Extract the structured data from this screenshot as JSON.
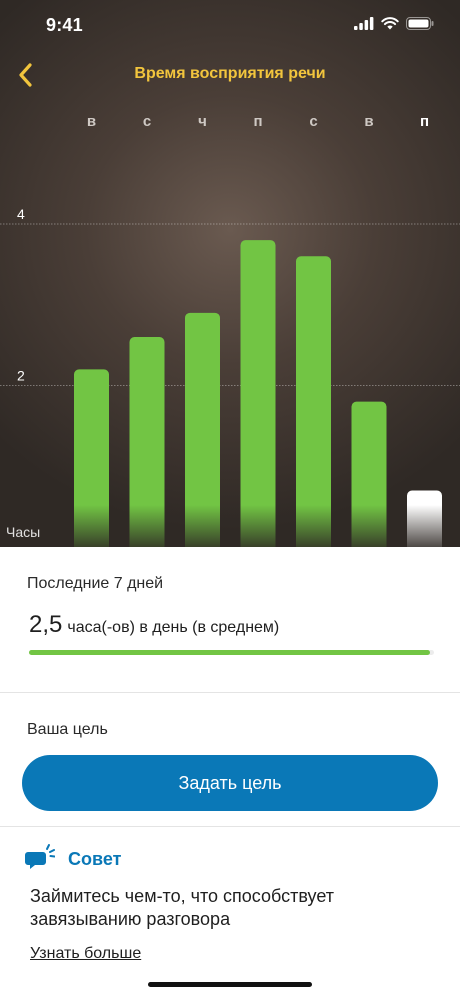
{
  "status_bar": {
    "time": "9:41",
    "icons": [
      "signal-icon",
      "wifi-icon",
      "battery-icon"
    ]
  },
  "nav": {
    "back_icon": "chevron-left-icon",
    "title": "Время восприятия речи"
  },
  "colors": {
    "accent_yellow": "#f2c53d",
    "bar_green": "#72c544",
    "bar_today": "#ffffff",
    "primary_blue": "#0a78b7"
  },
  "chart_data": {
    "type": "bar",
    "categories": [
      "в",
      "с",
      "ч",
      "п",
      "с",
      "в",
      "п"
    ],
    "values": [
      2.2,
      2.6,
      2.9,
      3.8,
      3.6,
      1.8,
      0.7
    ],
    "highlight_index": 6,
    "yticks": [
      2,
      4
    ],
    "ylabel": "Часы",
    "ylim": [
      0,
      4
    ],
    "grid": true
  },
  "summary": {
    "heading": "Последние 7 дней",
    "value": "2,5",
    "unit_text": "часа(-ов) в день (в среднем)",
    "progress_fraction": 0.99
  },
  "goal": {
    "heading": "Ваша цель",
    "button_label": "Задать цель"
  },
  "tip": {
    "icon": "chat-bubble-icon",
    "title": "Совет",
    "body": "Займитесь чем-то, что способствует завязыванию разговора",
    "link": "Узнать больше"
  }
}
